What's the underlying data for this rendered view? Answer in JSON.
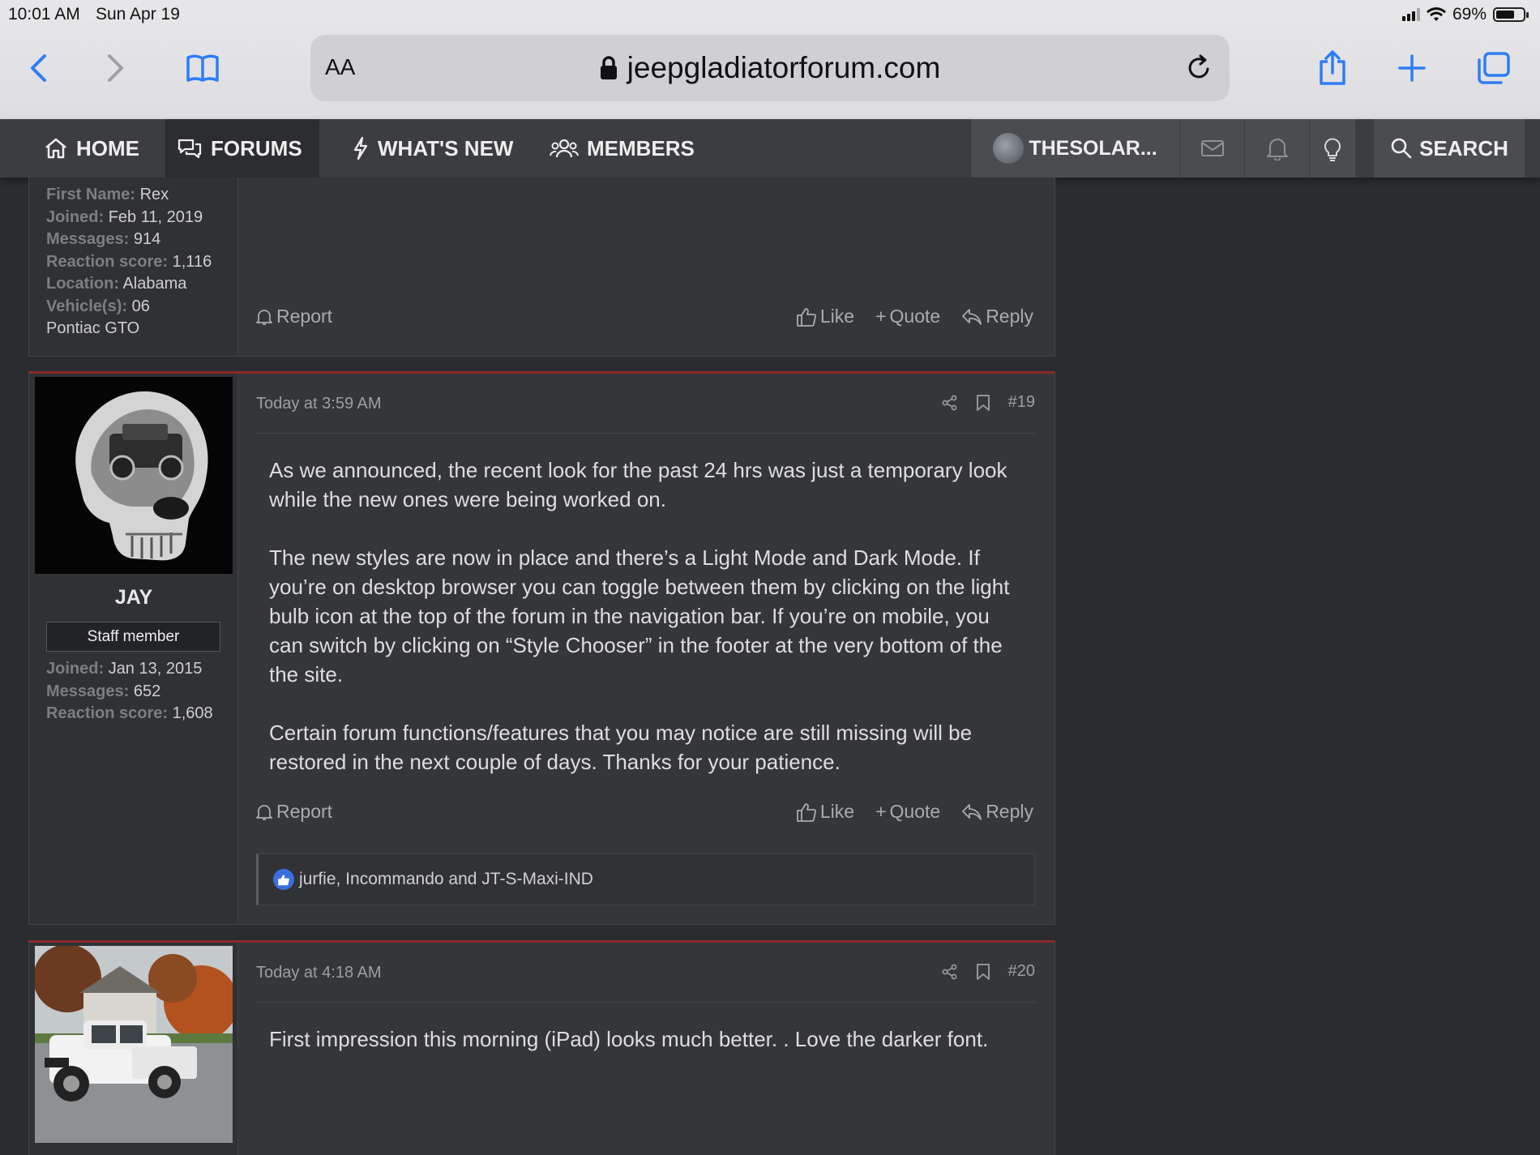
{
  "status": {
    "time": "10:01 AM",
    "date": "Sun Apr 19",
    "battery": "69%",
    "battery_level": 0.69
  },
  "browser": {
    "text_size_label": "AA",
    "url": "jeepgladiatorforum.com",
    "icons": [
      "back-icon",
      "forward-icon",
      "bookmarks-icon",
      "lock-icon",
      "reload-icon",
      "share-icon",
      "new-tab-icon",
      "tabs-icon"
    ]
  },
  "nav": {
    "home": "HOME",
    "forums": "FORUMS",
    "whats_new": "WHAT'S NEW",
    "members": "MEMBERS",
    "user": "THESOLAR...",
    "search": "SEARCH"
  },
  "post_prev": {
    "fields": [
      {
        "key": "First Name:",
        "value": "Rex"
      },
      {
        "key": "Joined:",
        "value": "Feb 11, 2019"
      },
      {
        "key": "Messages:",
        "value": "914"
      },
      {
        "key": "Reaction score:",
        "value": "1,116"
      },
      {
        "key": "Location:",
        "value": "Alabama"
      },
      {
        "key": "Vehicle(s):",
        "value": "06"
      }
    ],
    "vehicle_cont": "Pontiac GTO",
    "report": "Report",
    "like": "Like",
    "quote": "Quote",
    "reply": "Reply"
  },
  "post19": {
    "username": "JAY",
    "badge": "Staff member",
    "fields": [
      {
        "key": "Joined:",
        "value": "Jan 13, 2015"
      },
      {
        "key": "Messages:",
        "value": "652"
      },
      {
        "key": "Reaction score:",
        "value": "1,608"
      }
    ],
    "date": "Today at 3:59 AM",
    "number": "#19",
    "paragraphs": [
      "As we announced, the recent look for the past 24 hrs was just a temporary look while the new ones were being worked on.",
      "The new styles are now in place and there’s a Light Mode and Dark Mode. If you’re on desktop browser you can toggle between them by clicking on the light bulb icon at the top of the forum in the navigation bar. If you’re on mobile, you can switch by clicking on “Style Chooser” in the footer at the very bottom of the the site.",
      "Certain forum functions/features that you may notice are still missing will be restored in the next couple of days. Thanks for your patience."
    ],
    "report": "Report",
    "like": "Like",
    "quote": "Quote",
    "reply": "Reply",
    "reactions": "jurfie, Incommando and JT-S-Maxi-IND"
  },
  "post20": {
    "date": "Today at 4:18 AM",
    "number": "#20",
    "text": "First impression this morning (iPad) looks much better. . Love the darker font."
  }
}
